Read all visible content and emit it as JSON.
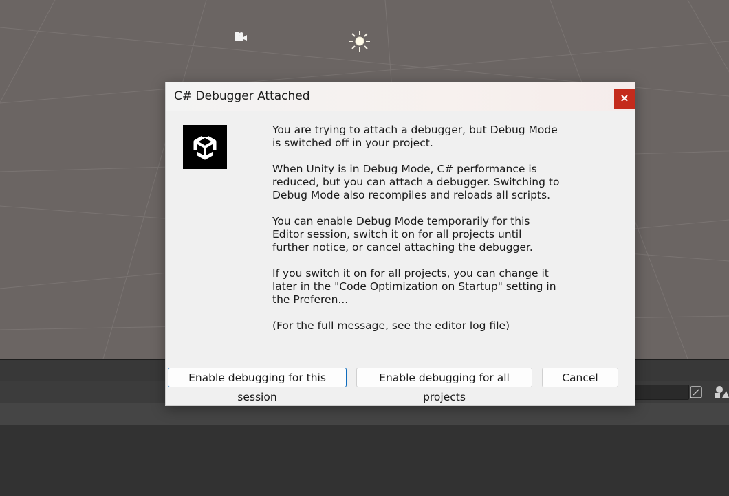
{
  "dialog": {
    "title": "C# Debugger Attached",
    "close_glyph": "×",
    "paragraphs": [
      "You are trying to attach a debugger, but Debug Mode is switched off in your project.",
      "When Unity is in Debug Mode, C# performance is reduced, but you can attach a debugger. Switching to Debug Mode also recompiles and reloads all scripts.",
      "You can enable Debug Mode temporarily for this Editor session, switch it on for all projects until further notice, or cancel attaching the debugger.",
      "If you switch it on for all projects, you can change it later in the \"Code Optimization on Startup\" setting in the Preferen...",
      "(For the full message, see the editor log file)"
    ],
    "buttons": {
      "session": "Enable debugging for this session",
      "all_projects": "Enable debugging for all projects",
      "cancel": "Cancel"
    }
  },
  "icons": {
    "logo": "unity-logo-icon",
    "camera": "camera-gizmo-icon",
    "light": "sun-light-gizmo-icon",
    "close": "close-icon"
  },
  "colors": {
    "close_button": "#c42b1c",
    "default_button_border": "#0f6cbd",
    "scene_background": "#6b6563"
  }
}
